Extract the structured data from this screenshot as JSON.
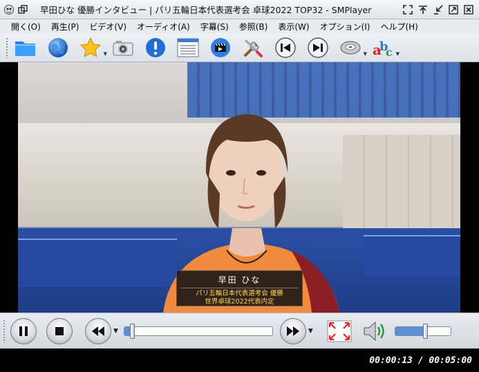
{
  "window": {
    "title": "早田ひな 優勝インタビュー | パリ五輪日本代表選考会 卓球2022 TOP32 - SMPlayer"
  },
  "menu": {
    "items": [
      {
        "label": "開く(O)"
      },
      {
        "label": "再生(P)"
      },
      {
        "label": "ビデオ(V)"
      },
      {
        "label": "オーディオ(A)"
      },
      {
        "label": "字幕(S)"
      },
      {
        "label": "参照(B)"
      },
      {
        "label": "表示(W)"
      },
      {
        "label": "オプション(I)"
      },
      {
        "label": "ヘルプ(H)"
      }
    ]
  },
  "toolbar": {
    "icons": [
      "open-folder-icon",
      "globe-icon",
      "favorites-star-icon",
      "screenshot-camera-icon",
      "info-icon",
      "playlist-icon",
      "video-clip-icon",
      "preferences-tools-icon",
      "previous-icon",
      "next-icon",
      "audio-cd-icon",
      "subtitles-abc-icon"
    ]
  },
  "video": {
    "caption": {
      "name": "早田 ひな",
      "line1": "パリ五輪日本代表選考会 優勝",
      "line2": "世界卓球2022代表内定"
    }
  },
  "controls": {
    "seek_progress": 0.04,
    "volume_level": 0.5
  },
  "status": {
    "time": "00:00:13 / 00:05:00"
  },
  "colors": {
    "accent": "#1f6fd6",
    "video_bg": "#000000"
  }
}
